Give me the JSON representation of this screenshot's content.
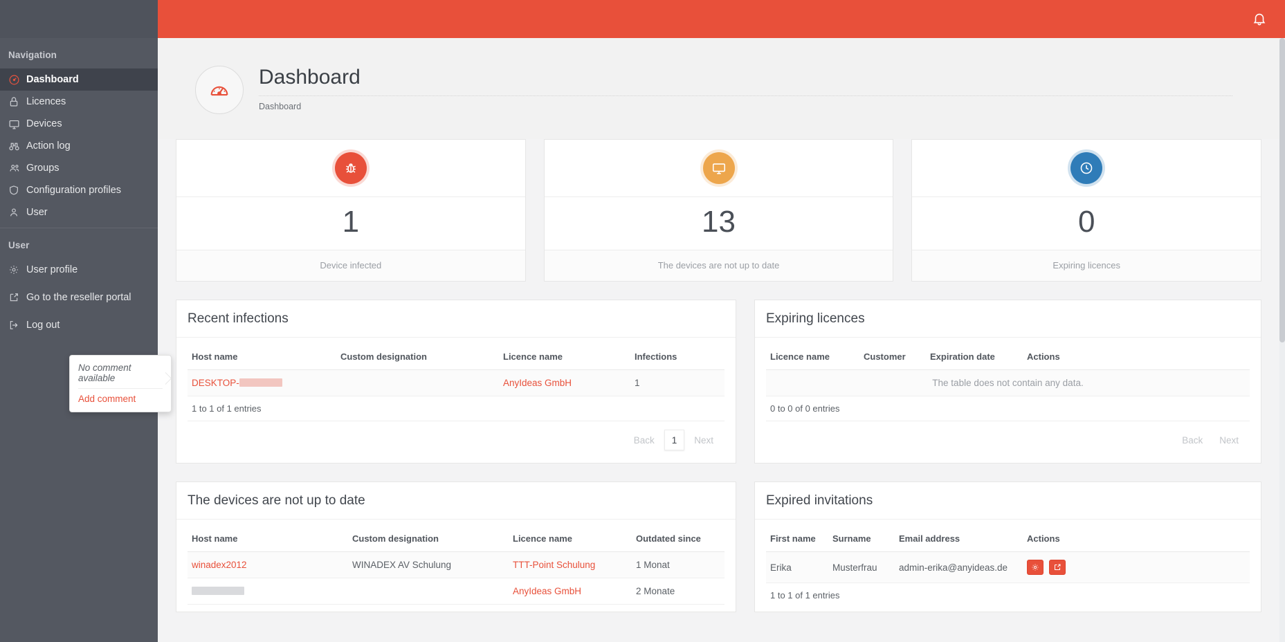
{
  "theme": {
    "accent": "#e8503a",
    "sidebar_bg": "#545861",
    "orange": "#eda64c",
    "blue": "#2f7cb8"
  },
  "topbar": {
    "bell_icon": "bell-icon"
  },
  "sidebar": {
    "nav_heading": "Navigation",
    "user_heading": "User",
    "nav_items": [
      {
        "label": "Dashboard",
        "icon": "gauge-icon",
        "active": true
      },
      {
        "label": "Licences",
        "icon": "lock-icon",
        "active": false
      },
      {
        "label": "Devices",
        "icon": "monitor-icon",
        "active": false
      },
      {
        "label": "Action log",
        "icon": "binoculars-icon",
        "active": false
      },
      {
        "label": "Groups",
        "icon": "users-icon",
        "active": false
      },
      {
        "label": "Configuration profiles",
        "icon": "shield-icon",
        "active": false
      },
      {
        "label": "User",
        "icon": "user-icon",
        "active": false
      }
    ],
    "user_items": [
      {
        "label": "User profile",
        "icon": "gear-icon"
      },
      {
        "label": "Go to the reseller portal",
        "icon": "external-link-icon"
      },
      {
        "label": "Log out",
        "icon": "logout-icon"
      }
    ]
  },
  "page": {
    "title": "Dashboard",
    "breadcrumb": "Dashboard",
    "icon": "gauge-icon"
  },
  "stats": [
    {
      "value": "1",
      "label": "Device infected",
      "icon": "bug-icon",
      "color": "red"
    },
    {
      "value": "13",
      "label": "The devices are not up to date",
      "icon": "monitor-icon",
      "color": "orange"
    },
    {
      "value": "0",
      "label": "Expiring licences",
      "icon": "clock-icon",
      "color": "blue"
    }
  ],
  "popover": {
    "note": "No comment available",
    "link": "Add comment"
  },
  "recent_infections": {
    "title": "Recent infections",
    "columns": [
      "Host name",
      "Custom designation",
      "Licence name",
      "Infections"
    ],
    "rows": [
      {
        "host": "DESKTOP-",
        "host_redacted": true,
        "designation": "",
        "licence": "AnyIdeas GmbH",
        "infections": "1"
      }
    ],
    "entries": "1 to 1 of 1 entries",
    "pager": {
      "back": "Back",
      "page": "1",
      "next": "Next"
    }
  },
  "expiring_licences": {
    "title": "Expiring licences",
    "columns": [
      "Licence name",
      "Customer",
      "Expiration date",
      "Actions"
    ],
    "empty": "The table does not contain any data.",
    "entries": "0 to 0 of 0 entries",
    "pager": {
      "back": "Back",
      "next": "Next"
    }
  },
  "devices_outdated": {
    "title": "The devices are not up to date",
    "columns": [
      "Host name",
      "Custom designation",
      "Licence name",
      "Outdated since"
    ],
    "rows": [
      {
        "host": "winadex2012",
        "host_redacted": false,
        "designation": "WINADEX AV Schulung",
        "licence": "TTT-Point Schulung",
        "since": "1 Monat"
      },
      {
        "host": "",
        "host_redacted": true,
        "designation": "",
        "licence": "AnyIdeas GmbH",
        "since": "2 Monate"
      }
    ]
  },
  "expired_invitations": {
    "title": "Expired invitations",
    "columns": [
      "First name",
      "Surname",
      "Email address",
      "Actions"
    ],
    "rows": [
      {
        "first": "Erika",
        "surname": "Musterfrau",
        "email": "admin-erika@anyideas.de",
        "actions": [
          "gear-icon",
          "resend-icon"
        ]
      }
    ],
    "entries": "1 to 1 of 1 entries"
  }
}
